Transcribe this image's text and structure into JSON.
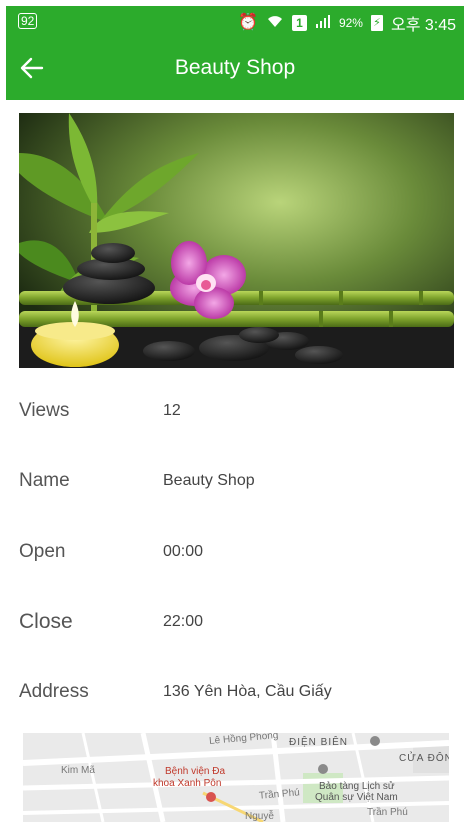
{
  "status_bar": {
    "left_badge": "92",
    "alarm_icon": "alarm-icon",
    "wifi_icon": "wifi-icon",
    "sim_label": "1",
    "signal_icon": "signal-icon",
    "battery_percent": "92%",
    "battery_icon": "battery-charging-icon",
    "time": "오후 3:45"
  },
  "app_bar": {
    "title": "Beauty Shop",
    "back_icon": "arrow-left-icon",
    "color": "#2cab2c"
  },
  "details": [
    {
      "label": "Views",
      "value": "12"
    },
    {
      "label": "Name",
      "value": "Beauty Shop"
    },
    {
      "label": "Open",
      "value": "00:00"
    },
    {
      "label": "Close",
      "value": "22:00"
    },
    {
      "label": "Address",
      "value": "136 Yên Hòa, Cầu Giấy"
    }
  ],
  "map": {
    "labels": {
      "road_hong_phong": "Lê Hồng Phong",
      "district_dien_bien": "ĐIỆN BIÊN",
      "cua_dong": "CỬA ĐÔN",
      "kim_ma": "Kim Mã",
      "hospital_1": "Bệnh viện Đa",
      "hospital_2": "khoa Xanh Pôn",
      "tran_phu": "Trần Phú",
      "museum_1": "Bảo tàng Lịch sử",
      "museum_2": "Quân sự Việt Nam",
      "tran_phu_2": "Trần Phú",
      "nguyen": "Nguyễ"
    }
  }
}
